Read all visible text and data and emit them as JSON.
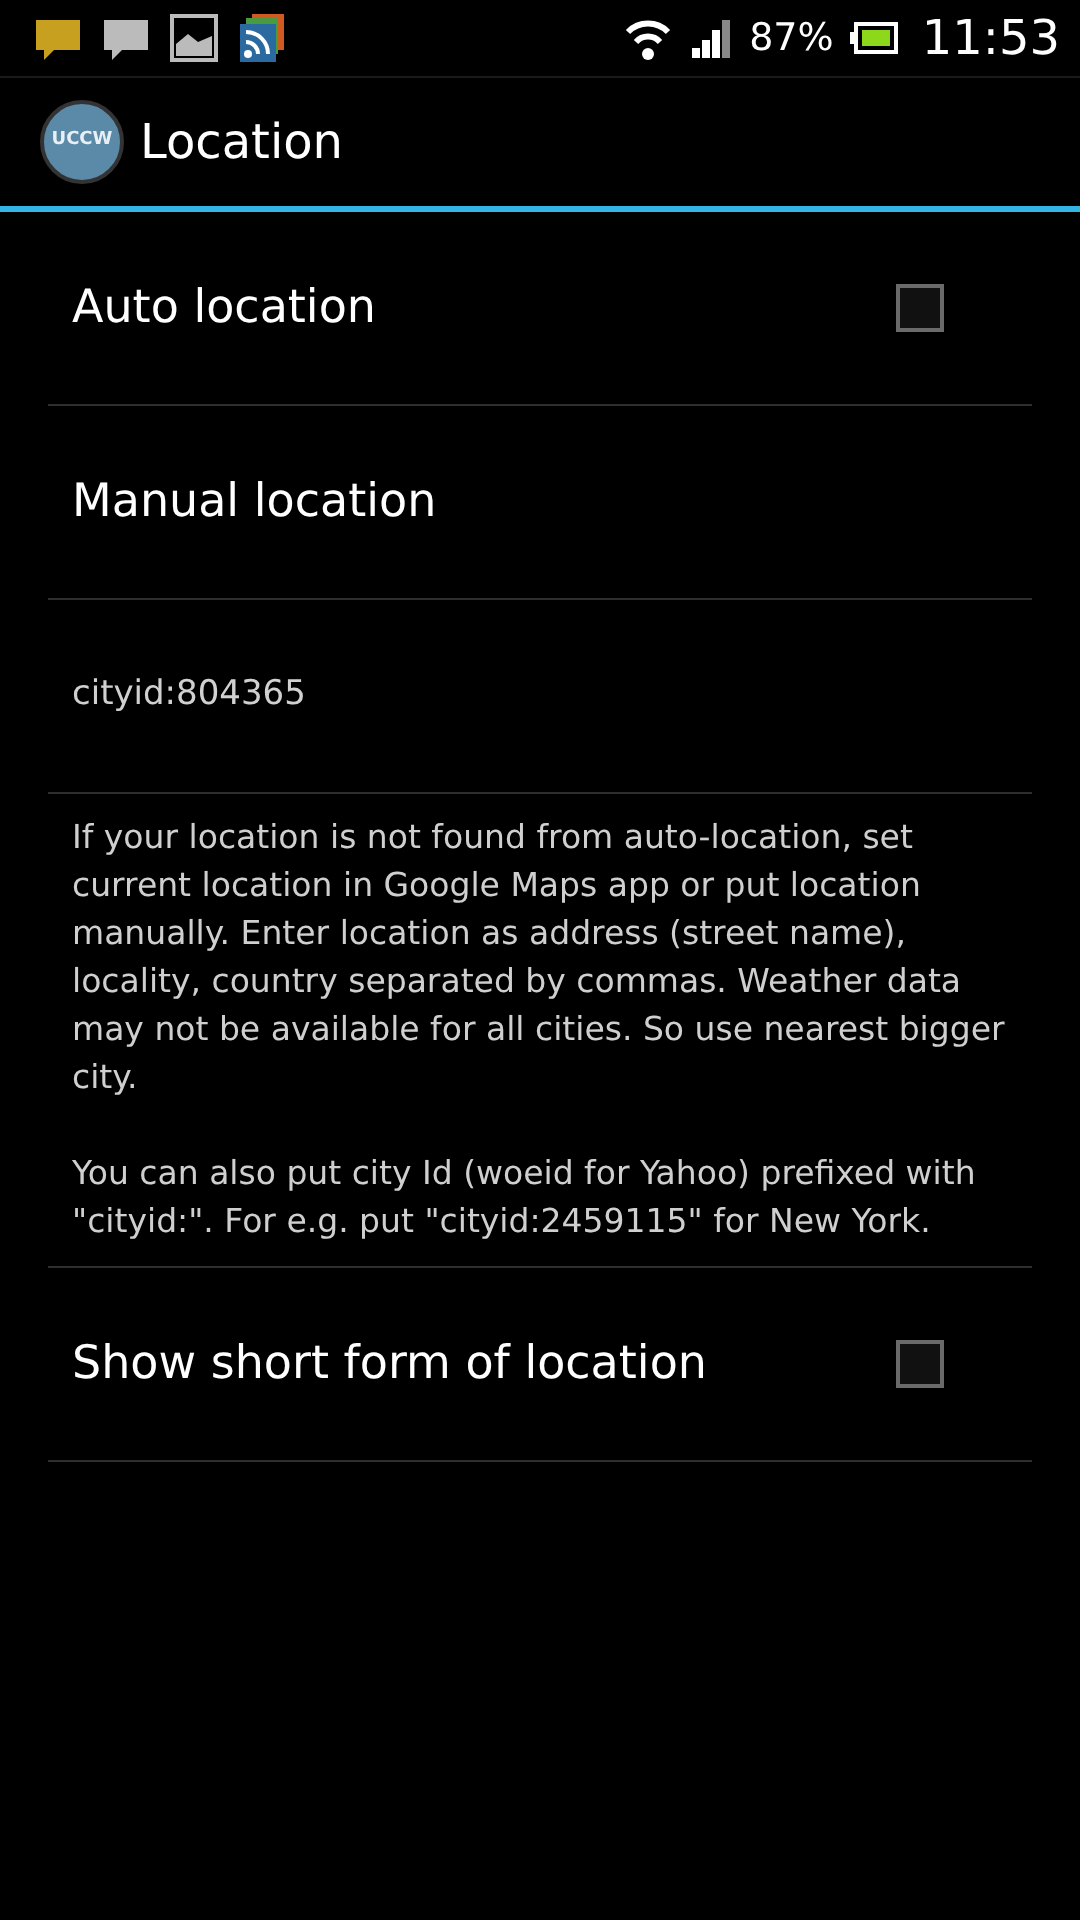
{
  "status_bar": {
    "notifications": [
      {
        "kind": "chat",
        "color": "#c8a020"
      },
      {
        "kind": "chat",
        "color": "#bbbbbb"
      },
      {
        "kind": "image"
      },
      {
        "kind": "rss"
      }
    ],
    "battery_percent": "87%",
    "time": "11:53"
  },
  "action_bar": {
    "app_icon_text": "UCCW",
    "title": "Location"
  },
  "preferences": [
    {
      "kind": "checkbox",
      "title": "Auto location",
      "checked": false
    },
    {
      "kind": "plain",
      "title": "Manual location"
    },
    {
      "kind": "value",
      "text": "cityid:804365"
    },
    {
      "kind": "note",
      "paragraphs": [
        "If your location is not found from auto-location, set current location in Google Maps app or put location manually. Enter location as address (street name), locality, country separated by commas. Weather data may not be available for all cities. So use nearest bigger city.",
        "You can also put city Id (woeid for Yahoo) prefixed with \"cityid:\". For e.g. put \"cityid:2459115\" for New York."
      ]
    },
    {
      "kind": "checkbox",
      "title": "Show short form of location",
      "checked": false
    }
  ]
}
